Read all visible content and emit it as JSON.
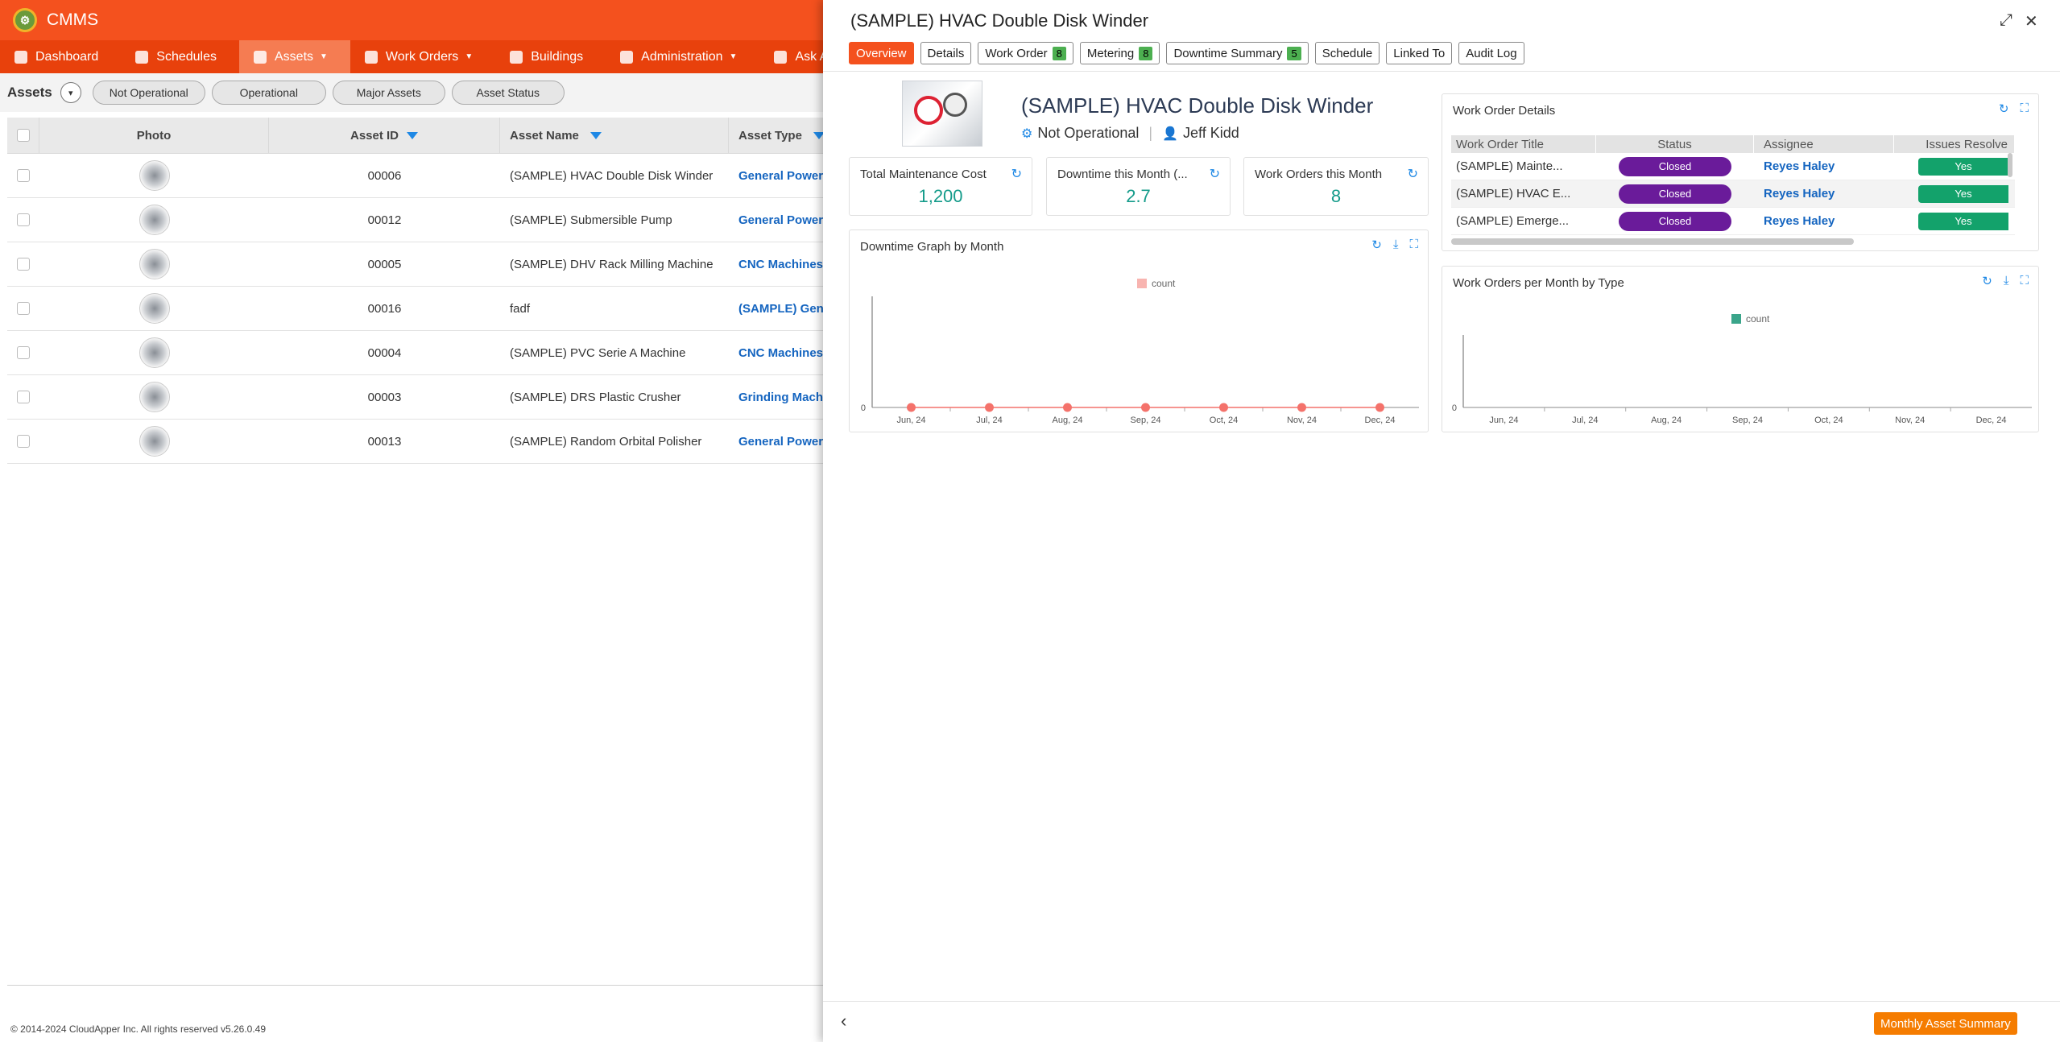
{
  "app": {
    "brand": "CMMS",
    "logo_text": "⚙"
  },
  "nav": [
    {
      "label": "Dashboard",
      "caret": false,
      "color": "#ffffff"
    },
    {
      "label": "Schedules",
      "caret": false,
      "color": "#ffffff"
    },
    {
      "label": "Assets",
      "caret": true,
      "active": true,
      "color": "#ffffff"
    },
    {
      "label": "Work Orders",
      "caret": true,
      "color": "#ffffff"
    },
    {
      "label": "Buildings",
      "caret": false,
      "color": "#ffffff"
    },
    {
      "label": "Administration",
      "caret": true,
      "color": "#ffffff"
    },
    {
      "label": "Ask AI",
      "caret": false,
      "color": "#ffffff"
    }
  ],
  "assets_page": {
    "title": "Assets",
    "filters": [
      "Not Operational",
      "Operational",
      "Major Assets",
      "Asset Status"
    ],
    "columns": {
      "photo": "Photo",
      "asset_id": "Asset ID",
      "asset_name": "Asset Name",
      "asset_type": "Asset Type"
    },
    "rows": [
      {
        "id": "00006",
        "name": "(SAMPLE) HVAC Double Disk Winder",
        "type": "General Power T"
      },
      {
        "id": "00012",
        "name": "(SAMPLE) Submersible Pump",
        "type": "General Power T"
      },
      {
        "id": "00005",
        "name": "(SAMPLE) DHV Rack Milling Machine",
        "type": "CNC Machines"
      },
      {
        "id": "00016",
        "name": "fadf",
        "type": "(SAMPLE) Gener"
      },
      {
        "id": "00004",
        "name": "(SAMPLE) PVC Serie A Machine",
        "type": "CNC Machines"
      },
      {
        "id": "00003",
        "name": "(SAMPLE) DRS Plastic Crusher",
        "type": "Grinding Machin"
      },
      {
        "id": "00013",
        "name": "(SAMPLE) Random Orbital Polisher",
        "type": "General Power T"
      }
    ],
    "footer": "© 2014-2024 CloudApper Inc. All rights reserved v5.26.0.49"
  },
  "panel": {
    "title": "(SAMPLE) HVAC Double Disk Winder",
    "expand_icon": "⤢",
    "close_icon": "✕",
    "tabs": [
      {
        "label": "Overview",
        "active": true
      },
      {
        "label": "Details"
      },
      {
        "label": "Work Order",
        "badge": "8"
      },
      {
        "label": "Metering",
        "badge": "8"
      },
      {
        "label": "Downtime Summary",
        "badge": "5"
      },
      {
        "label": "Schedule"
      },
      {
        "label": "Linked To"
      },
      {
        "label": "Audit Log"
      }
    ],
    "asset_name": "(SAMPLE) HVAC Double Disk Winder",
    "status": "Not Operational",
    "owner": "Jeff Kidd",
    "kpis": [
      {
        "label": "Total Maintenance Cost",
        "value": "1,200"
      },
      {
        "label": "Downtime this Month (...",
        "value": "2.7"
      },
      {
        "label": "Work Orders this Month",
        "value": "8"
      }
    ],
    "wo_details": {
      "title": "Work Order Details",
      "columns": [
        "Work Order Title",
        "Status",
        "Assignee",
        "Issues Resolve"
      ],
      "rows": [
        {
          "title": "(SAMPLE) Mainte...",
          "status": "Closed",
          "assignee": "Reyes Haley",
          "resolved": "Yes"
        },
        {
          "title": "(SAMPLE) HVAC E...",
          "status": "Closed",
          "assignee": "Reyes Haley",
          "resolved": "Yes"
        },
        {
          "title": "(SAMPLE) Emerge...",
          "status": "Closed",
          "assignee": "Reyes Haley",
          "resolved": "Yes"
        }
      ]
    },
    "back_icon": "‹",
    "summary_button": "Monthly Asset Summary"
  },
  "chart_data": [
    {
      "type": "line",
      "title": "Downtime Graph by Month",
      "categories": [
        "Jun, 24",
        "Jul, 24",
        "Aug, 24",
        "Sep, 24",
        "Oct, 24",
        "Nov, 24",
        "Dec, 24"
      ],
      "series": [
        {
          "name": "count",
          "values": [
            0,
            0,
            0,
            0,
            0,
            0,
            0
          ],
          "color": "#f4726b",
          "legend_color": "#f8b4b0"
        }
      ],
      "yticks": [
        "0"
      ],
      "legend": "top-center"
    },
    {
      "type": "bar",
      "title": "Work Orders per Month by Type",
      "categories": [
        "Jun, 24",
        "Jul, 24",
        "Aug, 24",
        "Sep, 24",
        "Oct, 24",
        "Nov, 24",
        "Dec, 24"
      ],
      "series": [
        {
          "name": "count",
          "values": [
            0,
            0,
            0,
            0,
            0,
            0,
            0
          ],
          "color": "#3aa58a"
        }
      ],
      "yticks": [
        "0"
      ],
      "legend": "top-center"
    }
  ]
}
